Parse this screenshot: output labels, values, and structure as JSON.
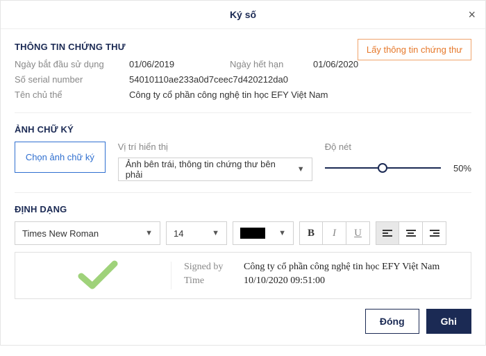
{
  "modal": {
    "title": "Ký số"
  },
  "cert": {
    "section": "THÔNG TIN CHỨNG THƯ",
    "fetch_btn": "Lấy thông tin chứng thư",
    "start_label": "Ngày bắt đầu sử dụng",
    "start_value": "01/06/2019",
    "end_label": "Ngày hết hạn",
    "end_value": "01/06/2020",
    "serial_label": "Số serial number",
    "serial_value": "54010110ae233a0d7ceec7d420212da0",
    "subject_label": "Tên chủ thể",
    "subject_value": "Công ty cổ phần công nghệ tin học EFY Việt Nam"
  },
  "sig": {
    "section": "ẢNH CHỮ KÝ",
    "choose_btn": "Chọn ảnh chữ ký",
    "pos_label": "Vị trí hiển thị",
    "pos_value": "Ảnh bên trái, thông tin chứng thư bên phải",
    "opacity_label": "Độ nét",
    "opacity_value": "50%"
  },
  "fmt": {
    "section": "ĐỊNH DẠNG",
    "font": "Times New Roman",
    "size": "14",
    "bold": "B",
    "italic": "I",
    "underline": "U"
  },
  "preview": {
    "signed_by_label": "Signed by",
    "signed_by_value": "Công ty cổ phần công nghệ tin học EFY Việt Nam",
    "time_label": "Time",
    "time_value": "10/10/2020   09:51:00"
  },
  "footer": {
    "close": "Đóng",
    "save": "Ghi"
  }
}
